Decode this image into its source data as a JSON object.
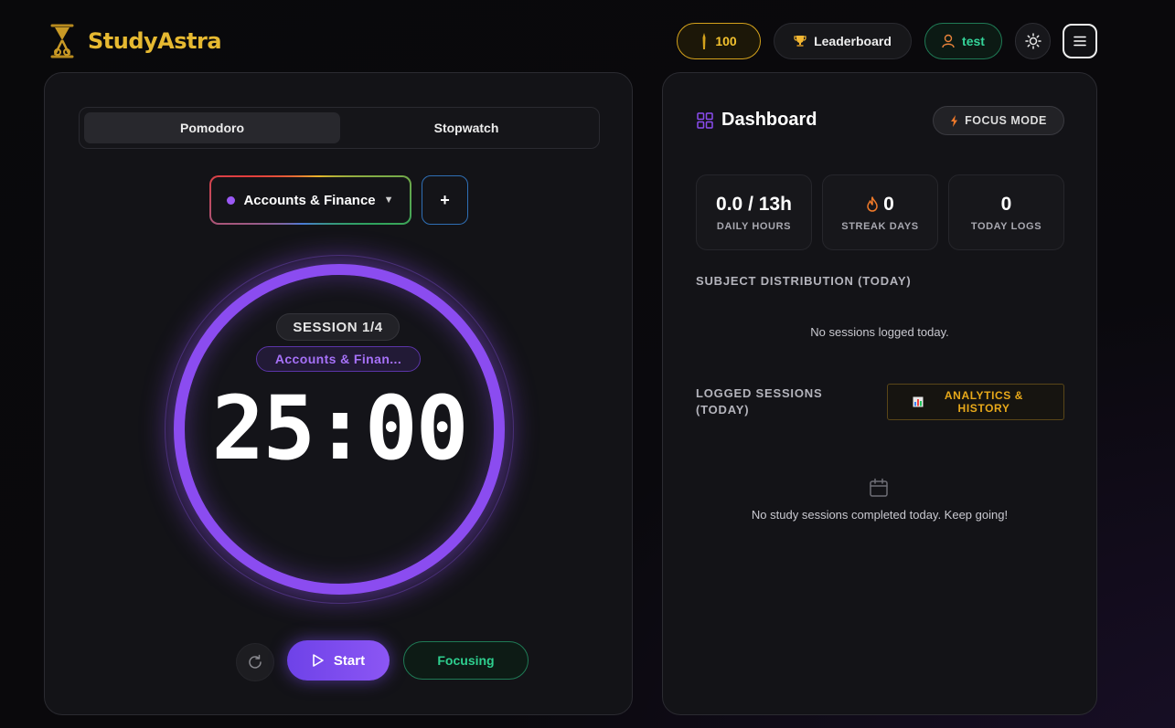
{
  "app": {
    "name": "StudyAstra"
  },
  "header": {
    "coins": "100",
    "leaderboard_label": "Leaderboard",
    "user_label": "test"
  },
  "timer": {
    "tabs": [
      {
        "label": "Pomodoro",
        "active": true
      },
      {
        "label": "Stopwatch",
        "active": false
      }
    ],
    "selected_subject": "Accounts & Finance",
    "add_subject_label": "+",
    "session_label": "SESSION 1/4",
    "subject_badge": "Accounts & Finan...",
    "time": "25:00",
    "start_label": "Start",
    "focusing_label": "Focusing",
    "ring_progress": 1.0
  },
  "dashboard": {
    "title": "Dashboard",
    "focus_mode_label": "FOCUS MODE",
    "stats": [
      {
        "value": "0.0 / 13h",
        "label": "DAILY HOURS"
      },
      {
        "value": "0",
        "label": "STREAK DAYS"
      },
      {
        "value": "0",
        "label": "TODAY LOGS"
      }
    ],
    "subject_distribution": {
      "heading": "SUBJECT DISTRIBUTION (TODAY)",
      "empty_text": "No sessions logged today."
    },
    "logged_sessions": {
      "heading": "LOGGED SESSIONS (TODAY)",
      "analytics_label": "ANALYTICS & HISTORY",
      "empty_text": "No study sessions completed today. Keep going!"
    }
  },
  "colors": {
    "brand": "#e6b931",
    "accent": "#8b4cf0",
    "success": "#34d399",
    "warning": "#e8a91a"
  },
  "icons": {
    "logo": "hourglass-icon",
    "coins": "coin-icon",
    "leaderboard": "trophy-icon",
    "user": "user-icon",
    "theme": "sun-icon",
    "menu": "hamburger-menu-icon",
    "dashboard": "grid-icon",
    "focus_mode": "bolt-icon",
    "streak": "flame-icon",
    "analytics": "chart-icon",
    "empty_sessions": "calendar-icon",
    "reset": "reset-icon",
    "start": "play-icon"
  }
}
